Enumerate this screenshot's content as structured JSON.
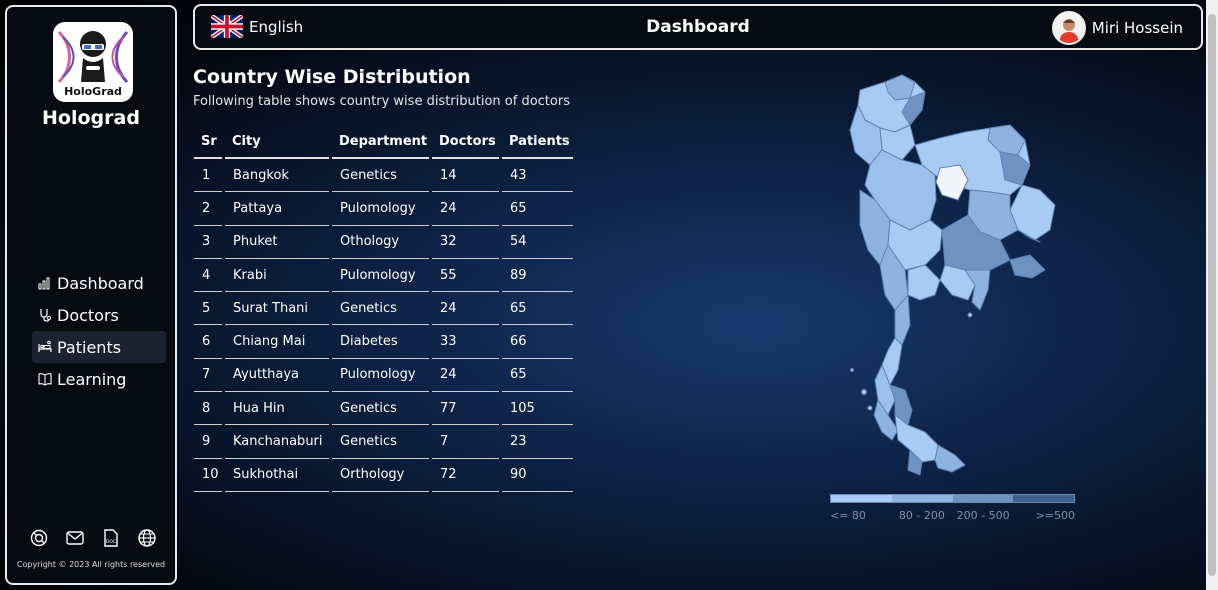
{
  "sidebar": {
    "logo_text": "HoloGrad",
    "brand": "Holograd",
    "nav": [
      {
        "label": "Dashboard",
        "icon": "bar-chart-icon"
      },
      {
        "label": "Doctors",
        "icon": "stethoscope-icon"
      },
      {
        "label": "Patients",
        "icon": "patient-bed-icon"
      },
      {
        "label": "Learning",
        "icon": "book-icon"
      }
    ],
    "active_nav": "Patients",
    "footer_icons": [
      "support-icon",
      "mail-icon",
      "doc-file-icon",
      "globe-icon"
    ],
    "copyright": "Copyright © 2023 All rights reserved"
  },
  "header": {
    "language": "English",
    "language_icon": "uk-flag-icon",
    "title": "Dashboard",
    "user_name": "Miri Hossein"
  },
  "main": {
    "title": "Country Wise Distribution",
    "subtitle": "Following table shows country wise distribution of doctors",
    "table": {
      "columns": [
        "Sr",
        "City",
        "Department",
        "Doctors",
        "Patients"
      ],
      "rows": [
        [
          "1",
          "Bangkok",
          "Genetics",
          "14",
          "43"
        ],
        [
          "2",
          "Pattaya",
          "Pulomology",
          "24",
          "65"
        ],
        [
          "3",
          "Phuket",
          "Othology",
          "32",
          "54"
        ],
        [
          "4",
          "Krabi",
          "Pulomology",
          "55",
          "89"
        ],
        [
          "5",
          "Surat Thani",
          "Genetics",
          "24",
          "65"
        ],
        [
          "6",
          "Chiang Mai",
          "Diabetes",
          "33",
          "66"
        ],
        [
          "7",
          "Ayutthaya",
          "Pulomology",
          "24",
          "65"
        ],
        [
          "8",
          "Hua Hin",
          "Genetics",
          "77",
          "105"
        ],
        [
          "9",
          "Kanchanaburi",
          "Genetics",
          "7",
          "23"
        ],
        [
          "10",
          "Sukhothai",
          "Orthology",
          "72",
          "90"
        ]
      ]
    }
  },
  "map": {
    "legend": [
      {
        "label": "<= 80",
        "color": "#a9cbf3"
      },
      {
        "label": "80 - 200",
        "color": "#8fb2de"
      },
      {
        "label": "200 - 500",
        "color": "#6f92c1"
      },
      {
        "label": ">=500",
        "color": "#3f5f93"
      }
    ]
  },
  "colors": {
    "background": "#0d2244",
    "panel_border": "#e8e8e8",
    "active_nav_bg": "#1b2230"
  }
}
